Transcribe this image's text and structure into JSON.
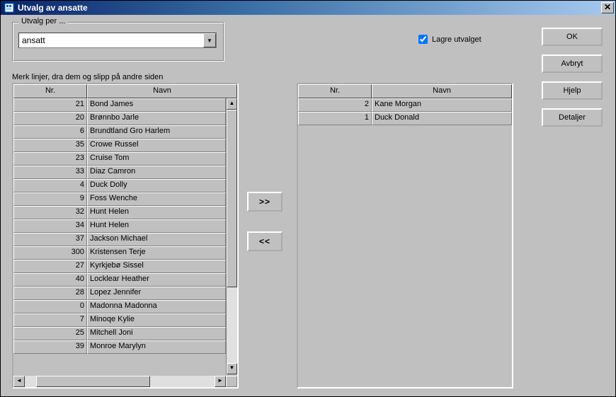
{
  "window": {
    "title": "Utvalg av ansatte"
  },
  "filter": {
    "legend": "Utvalg per ...",
    "combo_value": "ansatt"
  },
  "checkbox": {
    "label": "Lagre utvalget",
    "checked": true
  },
  "buttons": {
    "ok": "OK",
    "cancel": "Avbryt",
    "help": "Hjelp",
    "details": "Detaljer",
    "move_right": ">>",
    "move_left": "<<"
  },
  "hint": "Merk linjer, dra dem og slipp på andre siden",
  "columns": {
    "nr": "Nr.",
    "name": "Navn"
  },
  "left_rows": [
    {
      "nr": "21",
      "name": "Bond James"
    },
    {
      "nr": "20",
      "name": "Brønnbo Jarle"
    },
    {
      "nr": "6",
      "name": "Brundtland Gro Harlem"
    },
    {
      "nr": "35",
      "name": "Crowe Russel"
    },
    {
      "nr": "23",
      "name": "Cruise Tom"
    },
    {
      "nr": "33",
      "name": "Diaz Camron"
    },
    {
      "nr": "4",
      "name": "Duck Dolly"
    },
    {
      "nr": "9",
      "name": "Foss Wenche"
    },
    {
      "nr": "32",
      "name": "Hunt Helen"
    },
    {
      "nr": "34",
      "name": "Hunt Helen"
    },
    {
      "nr": "37",
      "name": "Jackson Michael"
    },
    {
      "nr": "300",
      "name": "Kristensen Terje"
    },
    {
      "nr": "27",
      "name": "Kyrkjebø Sissel"
    },
    {
      "nr": "40",
      "name": "Locklear Heather"
    },
    {
      "nr": "28",
      "name": "Lopez Jennifer"
    },
    {
      "nr": "0",
      "name": "Madonna Madonna"
    },
    {
      "nr": "7",
      "name": "Minoqe Kylie"
    },
    {
      "nr": "25",
      "name": "Mitchell Joni"
    },
    {
      "nr": "39",
      "name": "Monroe Marylyn"
    }
  ],
  "right_rows": [
    {
      "nr": "2",
      "name": "Kane Morgan"
    },
    {
      "nr": "1",
      "name": "Duck Donald"
    }
  ]
}
